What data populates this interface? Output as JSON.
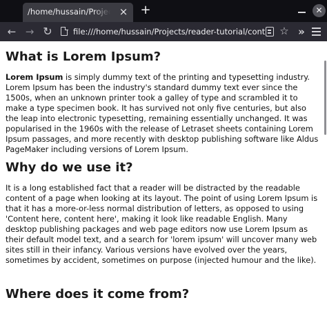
{
  "browser": {
    "tab_title": "/home/hussain/Projects/reader-tutorial/content.html",
    "tab_close_glyph": "×",
    "new_tab_glyph": "+",
    "url": "file:///home/hussain/Projects/reader-tutorial/content.html",
    "icons": {
      "back": "arrow-left-icon",
      "forward": "arrow-right-icon",
      "reload": "reload-icon",
      "page": "document-icon",
      "reader": "reader-view-icon",
      "bookmark": "star-icon",
      "overflow": "chevrons-right-icon",
      "menu": "hamburger-menu-icon",
      "minimize": "minimize-icon",
      "close": "close-icon"
    },
    "colors": {
      "tabbar": "#0f0f14",
      "active_tab": "#3b3b42",
      "toolbar": "#2b2a33"
    }
  },
  "page": {
    "sections": [
      {
        "heading": "What is Lorem Ipsum?",
        "lead_bold": "Lorem Ipsum",
        "body": " is simply dummy text of the printing and typesetting industry. Lorem Ipsum has been the industry's standard dummy text ever since the 1500s, when an unknown printer took a galley of type and scrambled it to make a type specimen book. It has survived not only five centuries, but also the leap into electronic typesetting, remaining essentially unchanged. It was popularised in the 1960s with the release of Letraset sheets containing Lorem Ipsum passages, and more recently with desktop publishing software like Aldus PageMaker including versions of Lorem Ipsum."
      },
      {
        "heading": "Why do we use it?",
        "body": "It is a long established fact that a reader will be distracted by the readable content of a page when looking at its layout. The point of using Lorem Ipsum is that it has a more-or-less normal distribution of letters, as opposed to using 'Content here, content here', making it look like readable English. Many desktop publishing packages and web page editors now use Lorem Ipsum as their default model text, and a search for 'lorem ipsum' will uncover many web sites still in their infancy. Various versions have evolved over the years, sometimes by accident, sometimes on purpose (injected humour and the like)."
      },
      {
        "heading": "Where does it come from?"
      }
    ]
  }
}
